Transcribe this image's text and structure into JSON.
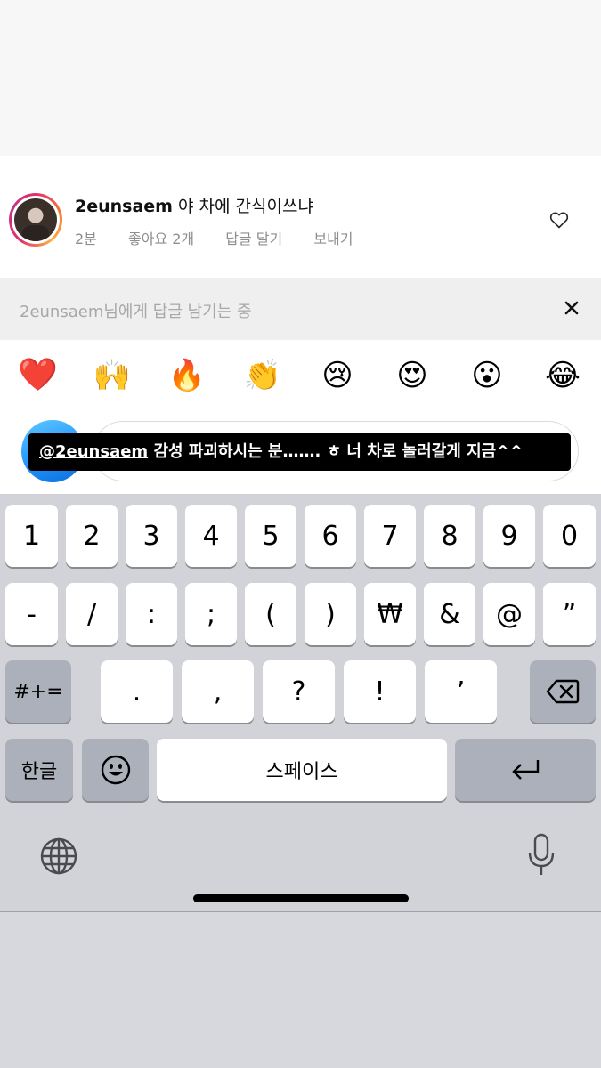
{
  "comment": {
    "username": "2eunsaem",
    "text": "야 차에 간식이쓰냐",
    "time": "2분",
    "likes": "좋아요 2개",
    "reply": "답글 달기",
    "send": "보내기"
  },
  "reply_bar": {
    "text": "2eunsaem님에게 답글 남기는 중",
    "close_icon": "close-icon"
  },
  "emojis": [
    "❤️",
    "🙌",
    "🔥",
    "👏",
    "😢",
    "😍",
    "😮",
    "😂"
  ],
  "input": {
    "mention": "@2eunsaem",
    "text": " 감성 파괴하시는 분……. ㅎ 너 차로 놀러갈게 지금^^"
  },
  "keyboard": {
    "row1": [
      "1",
      "2",
      "3",
      "4",
      "5",
      "6",
      "7",
      "8",
      "9",
      "0"
    ],
    "row2": [
      "-",
      "/",
      ":",
      ";",
      "(",
      ")",
      "₩",
      "&",
      "@",
      "”"
    ],
    "row3_left": "#+=",
    "row3": [
      ".",
      ",",
      "?",
      "!",
      "’"
    ],
    "hangul": "한글",
    "space": "스페이스",
    "emoji_icon": "smiley-icon",
    "backspace_icon": "backspace-icon",
    "return_icon": "return-icon",
    "globe_icon": "globe-icon",
    "mic_icon": "microphone-icon"
  }
}
